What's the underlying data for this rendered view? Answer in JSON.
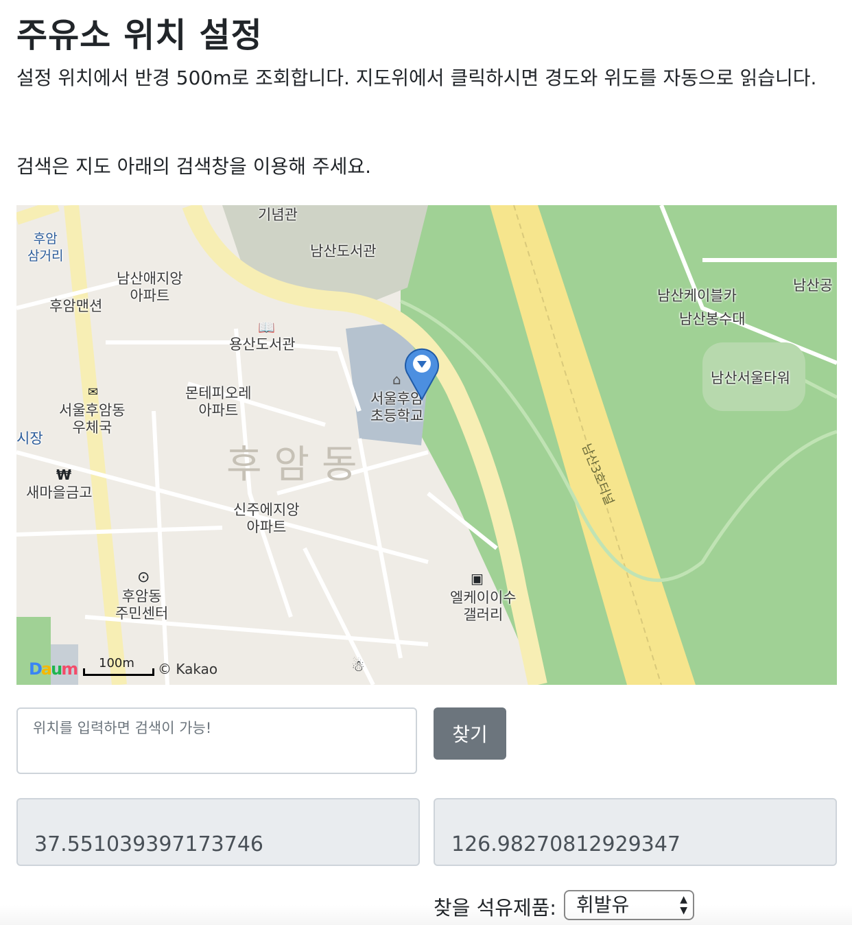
{
  "page": {
    "title": "주유소 위치 설정",
    "description": "설정 위치에서 반경 500m로 조회합니다. 지도위에서 클릭하시면 경도와 위도를 자동으로 읽습니다.",
    "search_hint": "검색은 지도 아래의 검색창을 이용해 주세요."
  },
  "map": {
    "labels": {
      "memorial": "기념관",
      "namsan_library": "남산도서관",
      "huam_junction": "후암\n삼거리",
      "namsan_apt": "남산애지앙\n아파트",
      "huam_mansion": "후암맨션",
      "yongsan_library": "용산도서관",
      "school": "서울후암\n초등학교",
      "cablecar": "남산케이블카",
      "bongsudae": "남산봉수대",
      "namsan_park": "남산공",
      "seoul_tower": "남산서울타워",
      "montepio_apt": "몬테피오레\n아파트",
      "post_office": "서울후암동\n우체국",
      "market": "시장",
      "saemaeul_bank": "새마을금고",
      "huam_dong": "후암동",
      "tunnel": "남산3호터널",
      "sinju_apt": "신주에지앙\n아파트",
      "community_center": "후암동\n주민센터",
      "gallery": "엘케이이수\n갤러리"
    },
    "logo": "Daum",
    "scale": "100m",
    "copyright": "© Kakao",
    "icons": [
      "book-icon",
      "school-icon",
      "post-icon",
      "bank-icon",
      "target-icon",
      "gallery-icon",
      "person-icon",
      "marker-icon"
    ]
  },
  "search": {
    "placeholder": "위치를 입력하면 검색이 가능!",
    "button_label": "찾기"
  },
  "coords": {
    "latitude": "37.551039397173746",
    "longitude": "126.98270812929347"
  },
  "product": {
    "label": "찾을 석유제품:",
    "selected": "휘발유"
  }
}
